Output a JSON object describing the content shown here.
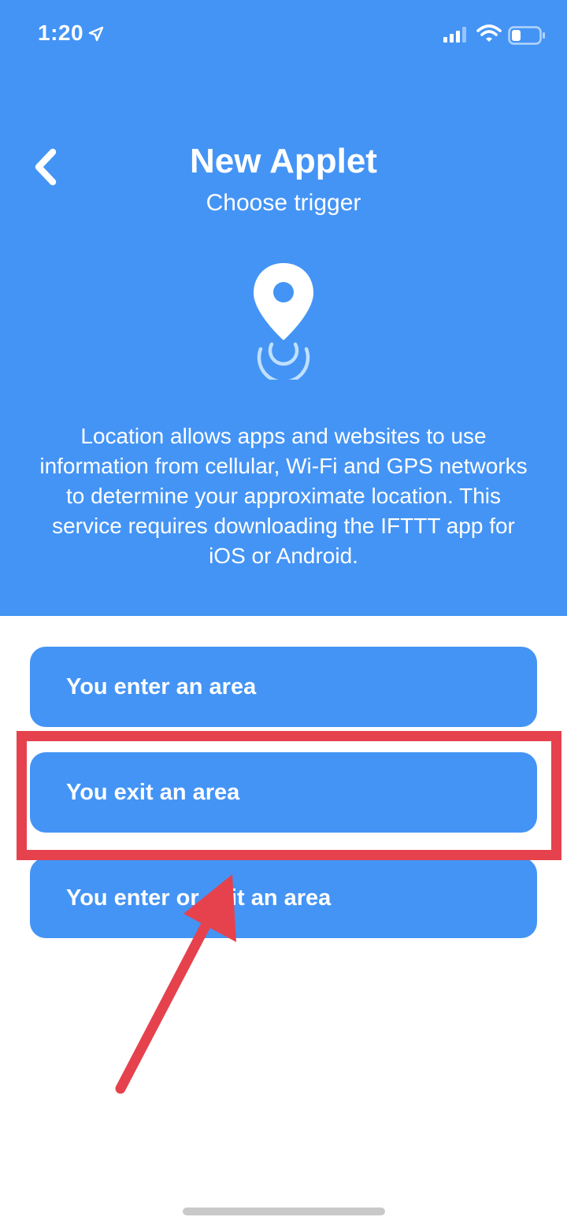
{
  "status_bar": {
    "time": "1:20",
    "icons": [
      "location-arrow-icon",
      "signal-icon",
      "wifi-icon",
      "battery-icon"
    ]
  },
  "header": {
    "back_icon": "chevron-left-icon",
    "title": "New Applet",
    "subtitle": "Choose trigger",
    "service_icon": "location-pin-icon",
    "description": "Location allows apps and websites to use information from cellular, Wi-Fi and GPS networks to determine your approximate location. This service requires downloading the IFTTT app for iOS or Android."
  },
  "triggers": [
    {
      "label": "You enter an area"
    },
    {
      "label": "You exit an area"
    },
    {
      "label": "You enter or exit an area"
    }
  ],
  "annotation": {
    "highlighted_trigger": "You exit an area",
    "color": "#e5424d"
  },
  "colors": {
    "accent": "#4494f5",
    "highlight": "#e5424d",
    "background": "#ffffff"
  }
}
